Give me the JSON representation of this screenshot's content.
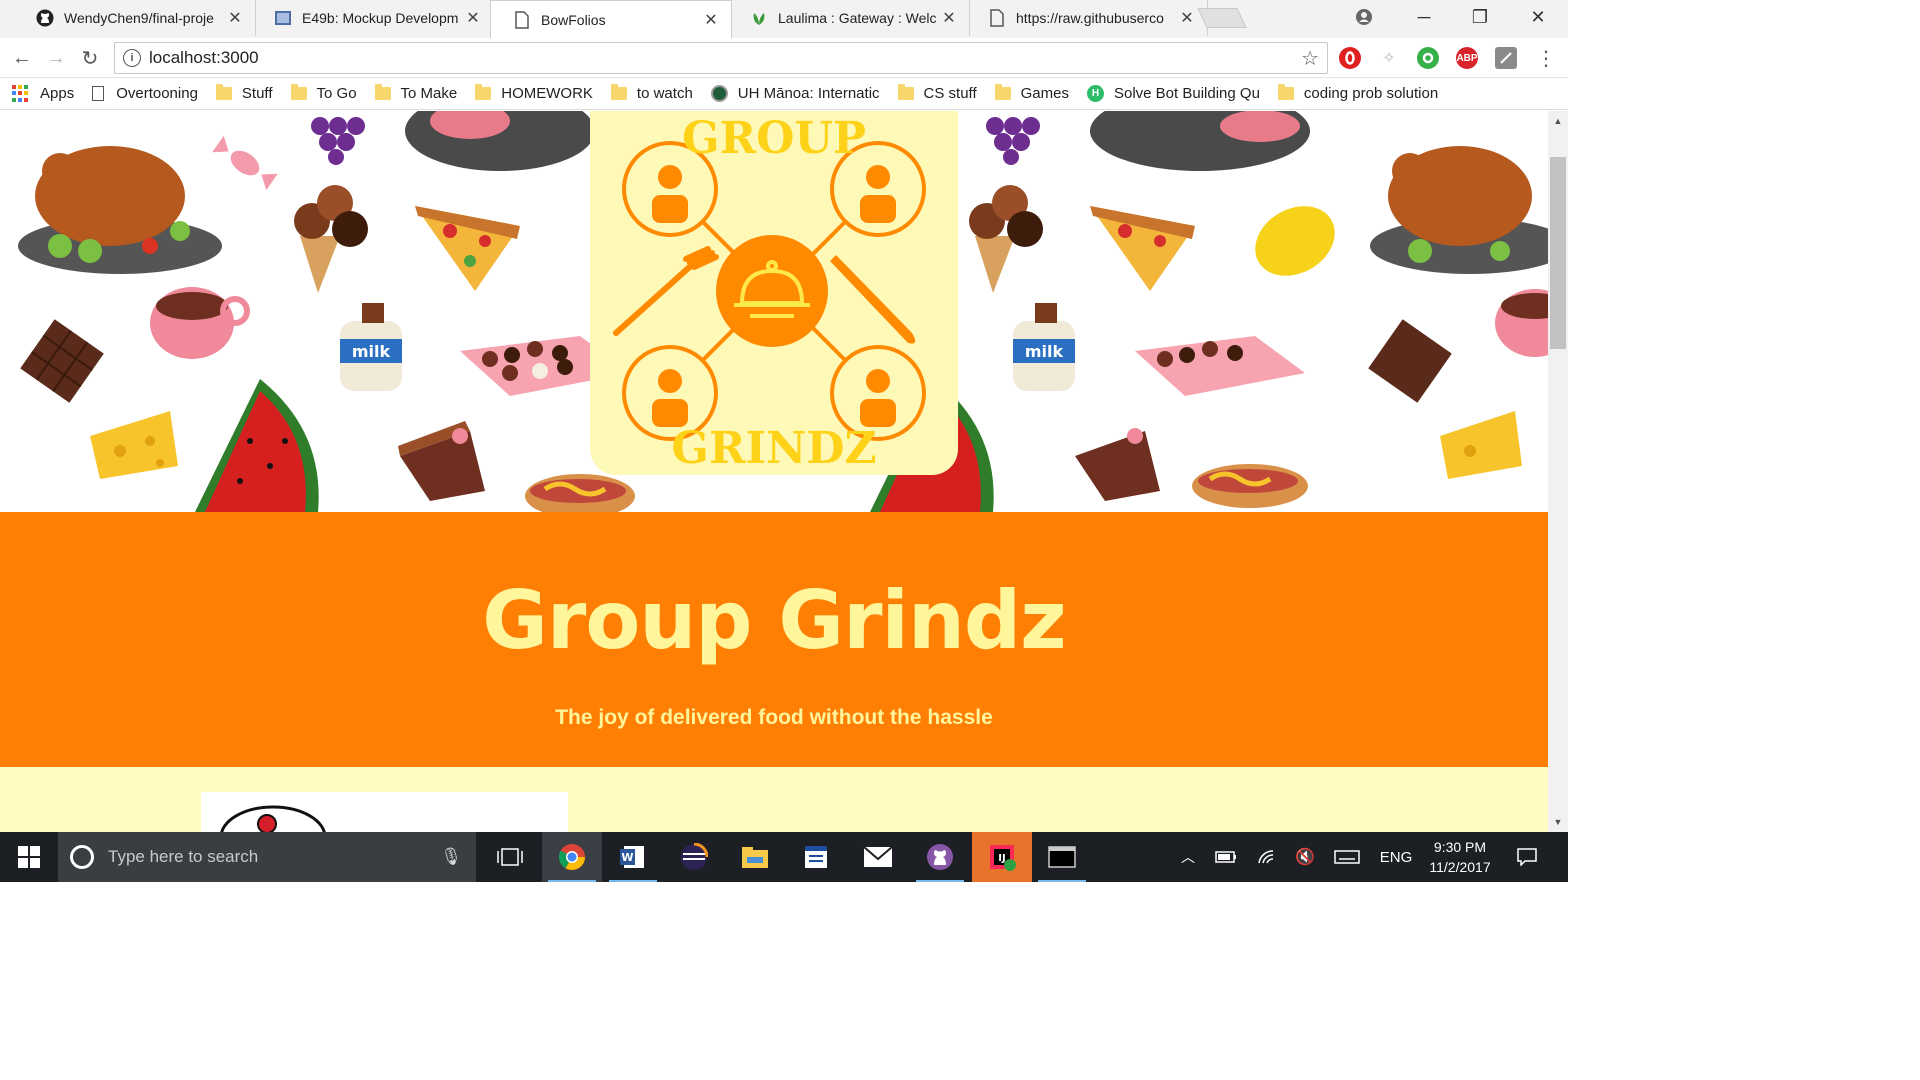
{
  "browser": {
    "tabs": [
      {
        "title": "WendyChen9/final-proje",
        "icon": "github-icon",
        "active": false
      },
      {
        "title": "E49b: Mockup Developm",
        "icon": "page-icon",
        "active": false
      },
      {
        "title": "BowFolios",
        "icon": "document-icon",
        "active": true
      },
      {
        "title": "Laulima : Gateway : Welc",
        "icon": "laulima-icon",
        "active": false
      },
      {
        "title": "https://raw.githubuserco",
        "icon": "document-icon",
        "active": false
      }
    ],
    "address": "localhost:3000",
    "bookmarks": [
      {
        "label": "Apps",
        "icon": "apps-grid-icon"
      },
      {
        "label": "Overtooning",
        "icon": "page-icon"
      },
      {
        "label": "Stuff",
        "icon": "folder-icon"
      },
      {
        "label": "To Go",
        "icon": "folder-icon"
      },
      {
        "label": "To Make",
        "icon": "folder-icon"
      },
      {
        "label": "HOMEWORK",
        "icon": "folder-icon"
      },
      {
        "label": "to watch",
        "icon": "folder-icon"
      },
      {
        "label": "UH Mānoa: Internatic",
        "icon": "uh-seal-icon"
      },
      {
        "label": "CS stuff",
        "icon": "folder-icon"
      },
      {
        "label": "Games",
        "icon": "folder-icon"
      },
      {
        "label": "Solve Bot Building Qu",
        "icon": "h-icon"
      },
      {
        "label": "coding prob solution",
        "icon": "folder-icon"
      }
    ],
    "extensions": {
      "abp_label": "ABP"
    }
  },
  "page": {
    "logo_text_top": "GROUP",
    "logo_text_bottom": "GRINDZ",
    "title": "Group Grindz",
    "tagline": "The joy of delivered food without the hassle",
    "milk_label": "milk"
  },
  "taskbar": {
    "search_placeholder": "Type here to search",
    "language": "ENG",
    "time": "9:30 PM",
    "date": "11/2/2017"
  },
  "colors": {
    "banner": "#ff7f05",
    "banner_text": "#fff59a",
    "logo_bg": "#fff9b8",
    "logo_orange": "#ff8a00"
  }
}
